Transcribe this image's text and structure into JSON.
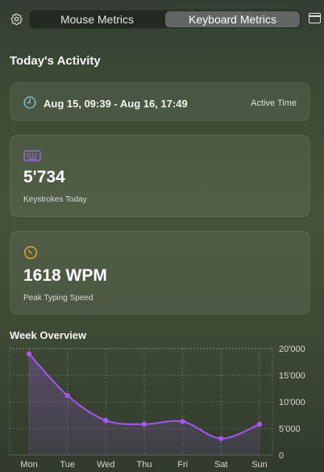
{
  "topbar": {
    "tabs": [
      {
        "label": "Mouse Metrics",
        "active": false
      },
      {
        "label": "Keyboard Metrics",
        "active": true
      }
    ],
    "settings_icon": "gear-icon",
    "window_icon": "window-icon"
  },
  "today": {
    "title": "Today's Activity",
    "time_range": "Aug 15, 09:39 - Aug 16, 17:49",
    "time_label": "Active Time",
    "keystrokes_value": "5'734",
    "keystrokes_label": "Keystrokes Today",
    "wpm_value": "1618 WPM",
    "wpm_label": "Peak Typing Speed"
  },
  "colors": {
    "clock": "#7fc3d9",
    "keyboard": "#a066e0",
    "gauge": "#e0a030",
    "line": "#a855f7"
  },
  "week": {
    "title": "Week Overview"
  },
  "chart_data": {
    "type": "area",
    "categories": [
      "Mon",
      "Tue",
      "Wed",
      "Thu",
      "Fri",
      "Sat",
      "Sun"
    ],
    "series": [
      {
        "values": [
          19000,
          11200,
          6500,
          5800,
          6300,
          3100,
          5800
        ]
      }
    ],
    "ylim": [
      0,
      20000
    ],
    "yticks": [
      0,
      5000,
      10000,
      15000,
      20000
    ],
    "ytick_labels": [
      "0",
      "5'000",
      "10'000",
      "15'000",
      "20'000"
    ],
    "grid": true
  }
}
